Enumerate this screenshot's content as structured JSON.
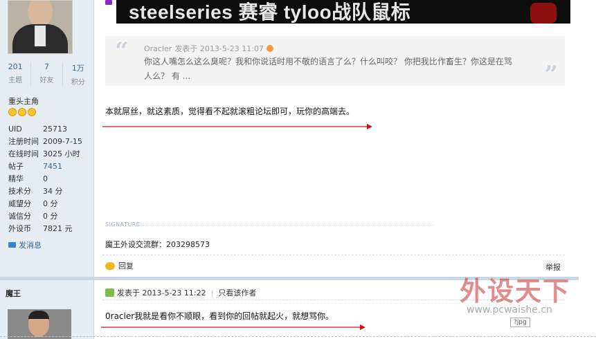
{
  "sidebar": {
    "stats": [
      {
        "num": "201",
        "label": "主题"
      },
      {
        "num": "7",
        "label": "好友"
      },
      {
        "num": "1万",
        "label": "积分"
      }
    ],
    "rank": "重头主角",
    "info": [
      {
        "key": "UID",
        "value": "25713"
      },
      {
        "key": "注册时间",
        "value": "2009-7-15"
      },
      {
        "key": "在线时间",
        "value": "3025 小时"
      },
      {
        "key": "帖子",
        "value": "7451"
      },
      {
        "key": "精华",
        "value": "0"
      },
      {
        "key": "技术分",
        "value": "34 分"
      },
      {
        "key": "威望分",
        "value": "0 分"
      },
      {
        "key": "诚信分",
        "value": "0 分"
      },
      {
        "key": "外设币",
        "value": "7821 元"
      }
    ],
    "send_message": "发消息",
    "second_user": "魔王"
  },
  "banner": {
    "text": "steelseries 赛睿 tyloo战队鼠标"
  },
  "post1": {
    "quote": {
      "author": "Oracler",
      "time": "发表于 2013-5-23 11:07",
      "text": "你这人嘴怎么这么臭呢？我和你说话时用不敬的语言了么？什么叫咬？ 你把我比作畜生？你这是在骂人么？ 有 ..."
    },
    "body": "本就屌丝，就这素质，觉得看不起就滚粗论坛即可，玩你的高端去。",
    "signature_label": "SIGNATURE",
    "signature": "魔王外设交流群：203298573",
    "reply": "回复",
    "report": "举报"
  },
  "post2": {
    "time": "发表于 2013-5-23 11:22",
    "only_author": "只看该作者",
    "body": "0racler我就是看你不顺眼，看到你的回帖就起火，就想骂你。"
  },
  "watermark": {
    "main": "外设天下",
    "url": "www.pcwaishe.cn"
  },
  "badge": "?jpg",
  "colors": {
    "sidebar_bg": "#e5edf2",
    "link": "#336699",
    "arrow": "#cc1111"
  }
}
